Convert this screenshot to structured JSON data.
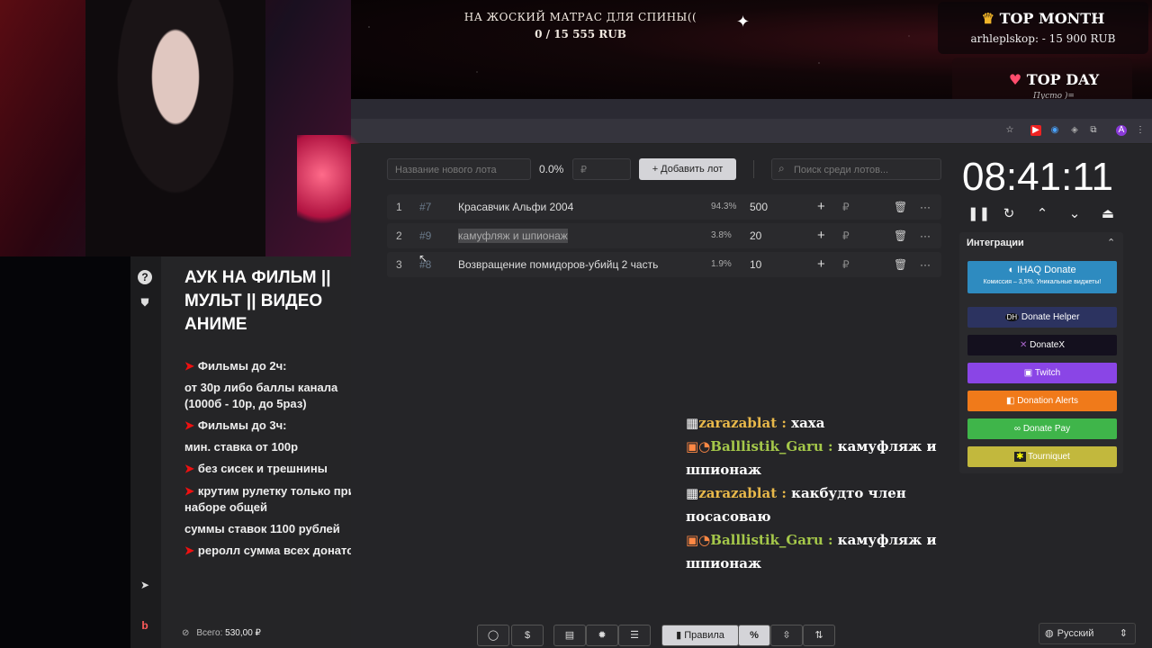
{
  "stream_overlay": {
    "goal_title": "НА ЖОСКИЙ МАТРАС ДЛЯ СПИНЫ((",
    "goal_progress": "0 / 15 555 RUB",
    "top_month_title": "TOP MONTH",
    "top_month_entry": "arhleplskop: - 15 900 RUB",
    "top_day_title": "TOP DAY",
    "top_day_entry": "Пусто )="
  },
  "left_panel": {
    "title": "АУК НА ФИЛЬМ || МУЛЬТ || ВИДЕО АНИМЕ",
    "rules": [
      "Фильмы до 2ч:",
      "от 30р либо баллы канала (1000б - 10р, до 5раз)",
      "Фильмы до 3ч:",
      "мин. ставка от 100р",
      "без сисек и трешнины",
      "крутим рулетку только при наборе общей",
      "суммы ставок 1100 рублей",
      "реролл сумма всех донатов"
    ],
    "total_label": "Всего:",
    "total_value": "530,00 ₽"
  },
  "toolbar": {
    "lot_name_placeholder": "Название нового лота",
    "percent": "0.0%",
    "amount_placeholder": "₽",
    "add_button": "Добавить лот",
    "search_placeholder": "Поиск среди лотов..."
  },
  "lots": [
    {
      "index": "1",
      "id": "#7",
      "name": "Красавчик Альфи 2004",
      "percent": "94.3%",
      "amount": "500"
    },
    {
      "index": "2",
      "id": "#9",
      "name": "камуфляж и шпионаж",
      "percent": "3.8%",
      "amount": "20"
    },
    {
      "index": "3",
      "id": "#8",
      "name": "Возвращение помидоров-убийц 2 часть",
      "percent": "1.9%",
      "amount": "10"
    }
  ],
  "timer": "08:41:11",
  "integrations": {
    "title": "Интеграции",
    "ihaq_label": "IHAQ Donate",
    "ihaq_sub": "Комиссия – 3,5%. Уникальные виджеты!",
    "buttons": [
      "Donate Helper",
      "DonateX",
      "Twitch",
      "Donation Alerts",
      "Donate Pay",
      "Tourniquet"
    ],
    "colors": {
      "ihaq": "#2e8bc0",
      "donate_helper": "#2c3360",
      "donatex": "#14101e",
      "twitch": "#8a45e6",
      "donation_alerts": "#f07a1a",
      "donate_pay": "#3fb54a",
      "tourniquet": "#c2b83d"
    }
  },
  "chat": [
    {
      "user": "zarazablat :",
      "text": "хаха"
    },
    {
      "user": "Balllistik_Garu :",
      "text": "камуфляж и шпионаж"
    },
    {
      "user": "zarazablat :",
      "text": "какбудто член посасоваю"
    },
    {
      "user": "Balllistik_Garu :",
      "text": "камуфляж и шпионаж"
    }
  ],
  "bottom": {
    "rules_label": "Правила",
    "percent_icon": "%",
    "language": "Русский"
  }
}
